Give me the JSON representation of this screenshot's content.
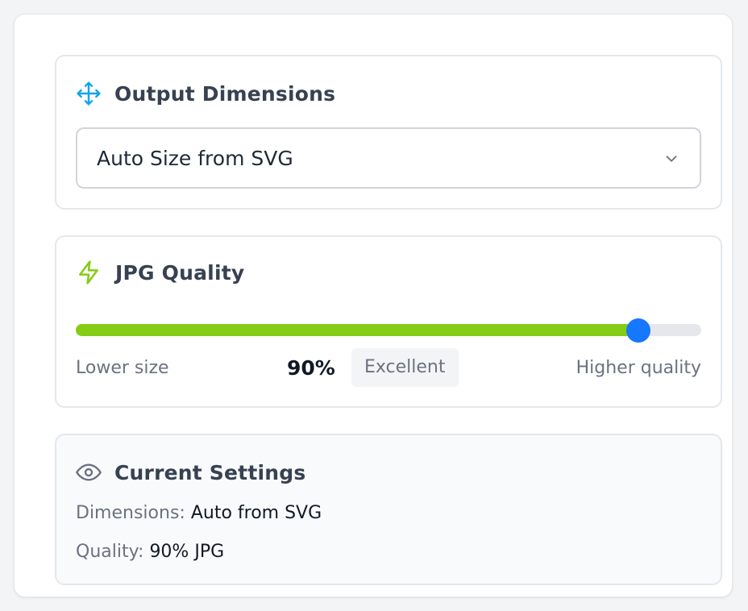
{
  "dimensions": {
    "title": "Output Dimensions",
    "icon": "move-arrows-icon",
    "selected": "Auto Size from SVG"
  },
  "quality": {
    "title": "JPG Quality",
    "icon": "lightning-icon",
    "value_percent": 90,
    "value_label": "90%",
    "rating": "Excellent",
    "min_label": "Lower size",
    "max_label": "Higher quality"
  },
  "current": {
    "title": "Current Settings",
    "icon": "eye-icon",
    "dimensions_key": "Dimensions:",
    "dimensions_value": "Auto from SVG",
    "quality_key": "Quality:",
    "quality_value": "90% JPG"
  },
  "colors": {
    "accent_blue": "#1677ff",
    "move_icon": "#0ea5e9",
    "quality_green": "#84cc16"
  }
}
